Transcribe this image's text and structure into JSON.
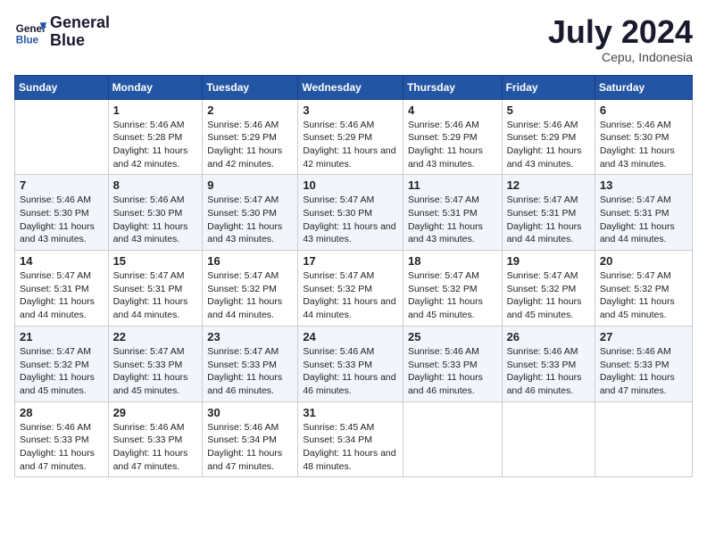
{
  "logo": {
    "line1": "General",
    "line2": "Blue"
  },
  "title": "July 2024",
  "location": "Cepu, Indonesia",
  "days_header": [
    "Sunday",
    "Monday",
    "Tuesday",
    "Wednesday",
    "Thursday",
    "Friday",
    "Saturday"
  ],
  "weeks": [
    [
      {
        "day": "",
        "info": ""
      },
      {
        "day": "1",
        "info": "Sunrise: 5:46 AM\nSunset: 5:28 PM\nDaylight: 11 hours and 42 minutes."
      },
      {
        "day": "2",
        "info": "Sunrise: 5:46 AM\nSunset: 5:29 PM\nDaylight: 11 hours and 42 minutes."
      },
      {
        "day": "3",
        "info": "Sunrise: 5:46 AM\nSunset: 5:29 PM\nDaylight: 11 hours and 42 minutes."
      },
      {
        "day": "4",
        "info": "Sunrise: 5:46 AM\nSunset: 5:29 PM\nDaylight: 11 hours and 43 minutes."
      },
      {
        "day": "5",
        "info": "Sunrise: 5:46 AM\nSunset: 5:29 PM\nDaylight: 11 hours and 43 minutes."
      },
      {
        "day": "6",
        "info": "Sunrise: 5:46 AM\nSunset: 5:30 PM\nDaylight: 11 hours and 43 minutes."
      }
    ],
    [
      {
        "day": "7",
        "info": "Sunrise: 5:46 AM\nSunset: 5:30 PM\nDaylight: 11 hours and 43 minutes."
      },
      {
        "day": "8",
        "info": "Sunrise: 5:46 AM\nSunset: 5:30 PM\nDaylight: 11 hours and 43 minutes."
      },
      {
        "day": "9",
        "info": "Sunrise: 5:47 AM\nSunset: 5:30 PM\nDaylight: 11 hours and 43 minutes."
      },
      {
        "day": "10",
        "info": "Sunrise: 5:47 AM\nSunset: 5:30 PM\nDaylight: 11 hours and 43 minutes."
      },
      {
        "day": "11",
        "info": "Sunrise: 5:47 AM\nSunset: 5:31 PM\nDaylight: 11 hours and 43 minutes."
      },
      {
        "day": "12",
        "info": "Sunrise: 5:47 AM\nSunset: 5:31 PM\nDaylight: 11 hours and 44 minutes."
      },
      {
        "day": "13",
        "info": "Sunrise: 5:47 AM\nSunset: 5:31 PM\nDaylight: 11 hours and 44 minutes."
      }
    ],
    [
      {
        "day": "14",
        "info": "Sunrise: 5:47 AM\nSunset: 5:31 PM\nDaylight: 11 hours and 44 minutes."
      },
      {
        "day": "15",
        "info": "Sunrise: 5:47 AM\nSunset: 5:31 PM\nDaylight: 11 hours and 44 minutes."
      },
      {
        "day": "16",
        "info": "Sunrise: 5:47 AM\nSunset: 5:32 PM\nDaylight: 11 hours and 44 minutes."
      },
      {
        "day": "17",
        "info": "Sunrise: 5:47 AM\nSunset: 5:32 PM\nDaylight: 11 hours and 44 minutes."
      },
      {
        "day": "18",
        "info": "Sunrise: 5:47 AM\nSunset: 5:32 PM\nDaylight: 11 hours and 45 minutes."
      },
      {
        "day": "19",
        "info": "Sunrise: 5:47 AM\nSunset: 5:32 PM\nDaylight: 11 hours and 45 minutes."
      },
      {
        "day": "20",
        "info": "Sunrise: 5:47 AM\nSunset: 5:32 PM\nDaylight: 11 hours and 45 minutes."
      }
    ],
    [
      {
        "day": "21",
        "info": "Sunrise: 5:47 AM\nSunset: 5:32 PM\nDaylight: 11 hours and 45 minutes."
      },
      {
        "day": "22",
        "info": "Sunrise: 5:47 AM\nSunset: 5:33 PM\nDaylight: 11 hours and 45 minutes."
      },
      {
        "day": "23",
        "info": "Sunrise: 5:47 AM\nSunset: 5:33 PM\nDaylight: 11 hours and 46 minutes."
      },
      {
        "day": "24",
        "info": "Sunrise: 5:46 AM\nSunset: 5:33 PM\nDaylight: 11 hours and 46 minutes."
      },
      {
        "day": "25",
        "info": "Sunrise: 5:46 AM\nSunset: 5:33 PM\nDaylight: 11 hours and 46 minutes."
      },
      {
        "day": "26",
        "info": "Sunrise: 5:46 AM\nSunset: 5:33 PM\nDaylight: 11 hours and 46 minutes."
      },
      {
        "day": "27",
        "info": "Sunrise: 5:46 AM\nSunset: 5:33 PM\nDaylight: 11 hours and 47 minutes."
      }
    ],
    [
      {
        "day": "28",
        "info": "Sunrise: 5:46 AM\nSunset: 5:33 PM\nDaylight: 11 hours and 47 minutes."
      },
      {
        "day": "29",
        "info": "Sunrise: 5:46 AM\nSunset: 5:33 PM\nDaylight: 11 hours and 47 minutes."
      },
      {
        "day": "30",
        "info": "Sunrise: 5:46 AM\nSunset: 5:34 PM\nDaylight: 11 hours and 47 minutes."
      },
      {
        "day": "31",
        "info": "Sunrise: 5:45 AM\nSunset: 5:34 PM\nDaylight: 11 hours and 48 minutes."
      },
      {
        "day": "",
        "info": ""
      },
      {
        "day": "",
        "info": ""
      },
      {
        "day": "",
        "info": ""
      }
    ]
  ]
}
